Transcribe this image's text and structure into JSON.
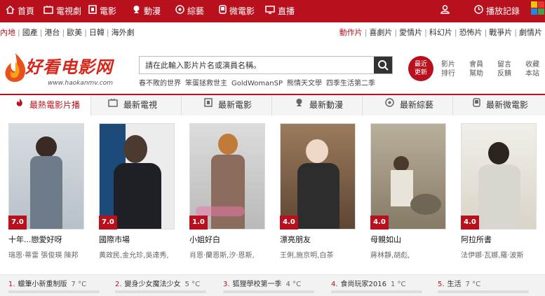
{
  "topnav": {
    "items": [
      {
        "label": "首頁",
        "icon": "home-icon"
      },
      {
        "label": "電視劇",
        "icon": "tv-icon"
      },
      {
        "label": "電影",
        "icon": "film-icon"
      },
      {
        "label": "動漫",
        "icon": "anime-icon"
      },
      {
        "label": "綜藝",
        "icon": "variety-icon"
      },
      {
        "label": "微電影",
        "icon": "micro-film-icon"
      },
      {
        "label": "直播",
        "icon": "live-icon"
      },
      {
        "label": "",
        "icon": "user-icon"
      },
      {
        "label": "播放記錄",
        "icon": "history-icon"
      }
    ]
  },
  "catbar": {
    "left": [
      "內地",
      "國產",
      "港台",
      "歐美",
      "日韓",
      "海外劇"
    ],
    "right": [
      "動作片",
      "喜劇片",
      "愛情片",
      "科幻片",
      "恐怖片",
      "戰爭片",
      "劇情片"
    ]
  },
  "header": {
    "logo_text": "好看电影网",
    "logo_url": "www.haokanmv.com",
    "search_placeholder": "請在此輸入影片片名或演員名稱。",
    "hotwords": [
      "春不敗的世界",
      "笨蛋拯救世主",
      "GoldWomanSP",
      "熊情天文學",
      "四季生活第二季"
    ],
    "recent_label_1": "最近",
    "recent_label_2": "更新",
    "quick_links": [
      {
        "l1": "影片",
        "l2": "排行"
      },
      {
        "l1": "會員",
        "l2": "幫助"
      },
      {
        "l1": "留言",
        "l2": "反饋"
      },
      {
        "l1": "收藏",
        "l2": "本站"
      }
    ]
  },
  "tabs": [
    {
      "label": "最熱電影片播",
      "icon": "hot-icon"
    },
    {
      "label": "最新電視",
      "icon": "tv-icon"
    },
    {
      "label": "最新電影",
      "icon": "film-icon"
    },
    {
      "label": "最新動漫",
      "icon": "anime-icon"
    },
    {
      "label": "最新綜藝",
      "icon": "variety-icon"
    },
    {
      "label": "最新微電影",
      "icon": "micro-film-icon"
    }
  ],
  "cards": [
    {
      "title": "十年...戀愛好呀",
      "score": "7.0",
      "actors": "瑞恩·蒂雷 張俊瑛 陳邦",
      "bg": "#c8cfd6",
      "fig": "#5d6f80"
    },
    {
      "title": "國際市場",
      "score": "7.0",
      "actors": "黃政民,金允珍,吳達秀,",
      "bg": "#e7e7e7",
      "fig": "#1e1f24"
    },
    {
      "title": "小姐好白",
      "score": "1.0",
      "actors": "肖恩·蘭恩斯,汐·恩斯,",
      "bg": "#cfcfcf",
      "fig": "#7d5a4a"
    },
    {
      "title": "漂亮朋友",
      "score": "4.0",
      "actors": "王俐,施京明,白茶",
      "bg": "#8a6a50",
      "fig": "#2a2a2a"
    },
    {
      "title": "母親如山",
      "score": "4.0",
      "actors": "蔣林靜,胡彪,",
      "bg": "#a49a86",
      "fig": "#d8d3c6"
    },
    {
      "title": "阿拉所書",
      "score": "4.0",
      "actors": "法伊娜·瓦娜,羅·波斯",
      "bg": "#ece9e2",
      "fig": "#3b3c2e"
    }
  ],
  "ranking": [
    {
      "num": "1.",
      "title": "蠟筆小新重制版",
      "temp": "7 °C"
    },
    {
      "num": "2.",
      "title": "變身少女魔法少女",
      "temp": "5 °C"
    },
    {
      "num": "3.",
      "title": "狐狸學校第一季",
      "temp": "4 °C"
    },
    {
      "num": "4.",
      "title": "食尚玩家2016",
      "temp": "1 °C"
    },
    {
      "num": "5.",
      "title": "生活",
      "temp": "7 °C"
    }
  ],
  "colors": {
    "brand_red": "#b8111d"
  }
}
